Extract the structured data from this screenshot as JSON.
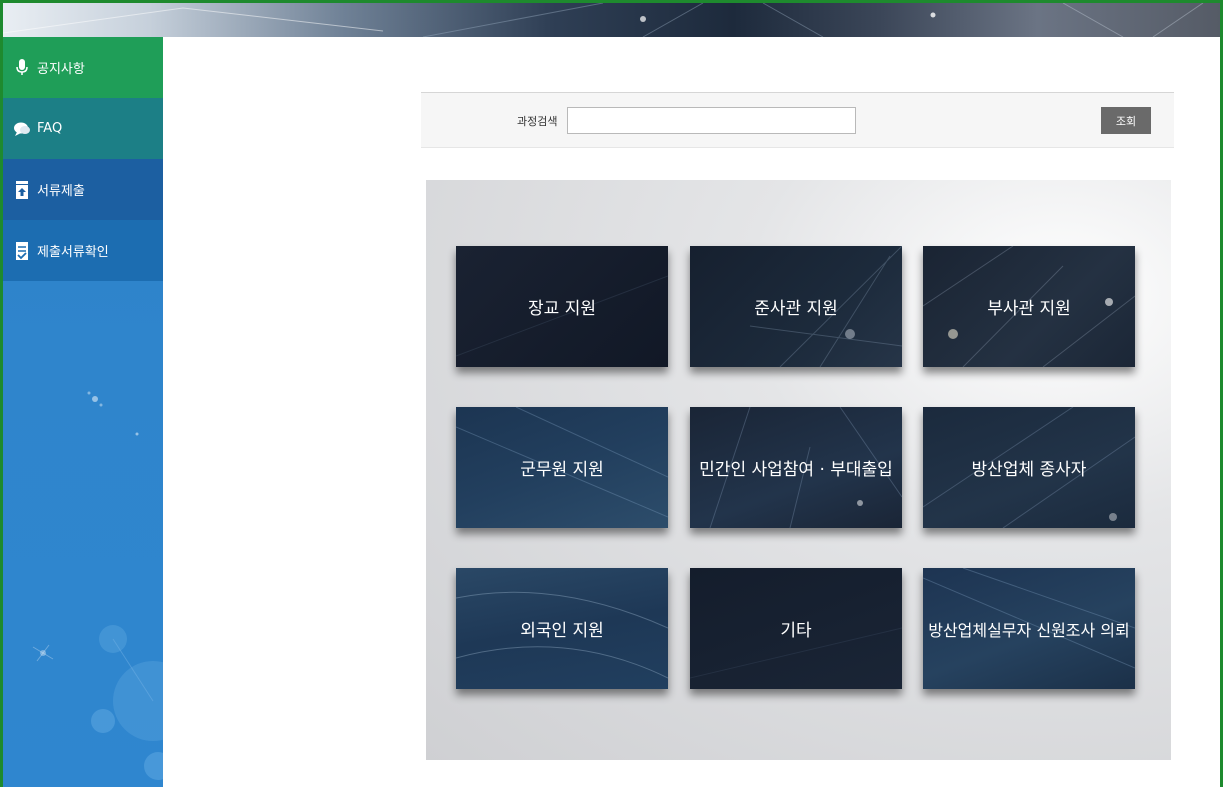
{
  "sidebar": {
    "items": [
      {
        "label": "공지사항",
        "icon": "microphone-icon"
      },
      {
        "label": "FAQ",
        "icon": "chat-bubble-icon"
      },
      {
        "label": "서류제출",
        "icon": "upload-document-icon"
      },
      {
        "label": "제출서류확인",
        "icon": "checklist-document-icon"
      }
    ]
  },
  "search": {
    "label": "과정검색",
    "value": "",
    "placeholder": "",
    "button_label": "조회"
  },
  "cards": [
    {
      "label": "장교 지원"
    },
    {
      "label": "준사관 지원"
    },
    {
      "label": "부사관 지원"
    },
    {
      "label": "군무원 지원"
    },
    {
      "label": "민간인 사업참여 · 부대출입"
    },
    {
      "label": "방산업체 종사자"
    },
    {
      "label": "외국인 지원"
    },
    {
      "label": "기타"
    },
    {
      "label": "방산업체실무자 신원조사 의뢰"
    }
  ],
  "colors": {
    "frame_border": "#1e8a2e",
    "sidebar_active": "#1f9e58",
    "sidebar_bg": "#2f85cc",
    "search_button": "#6a6a6a"
  }
}
